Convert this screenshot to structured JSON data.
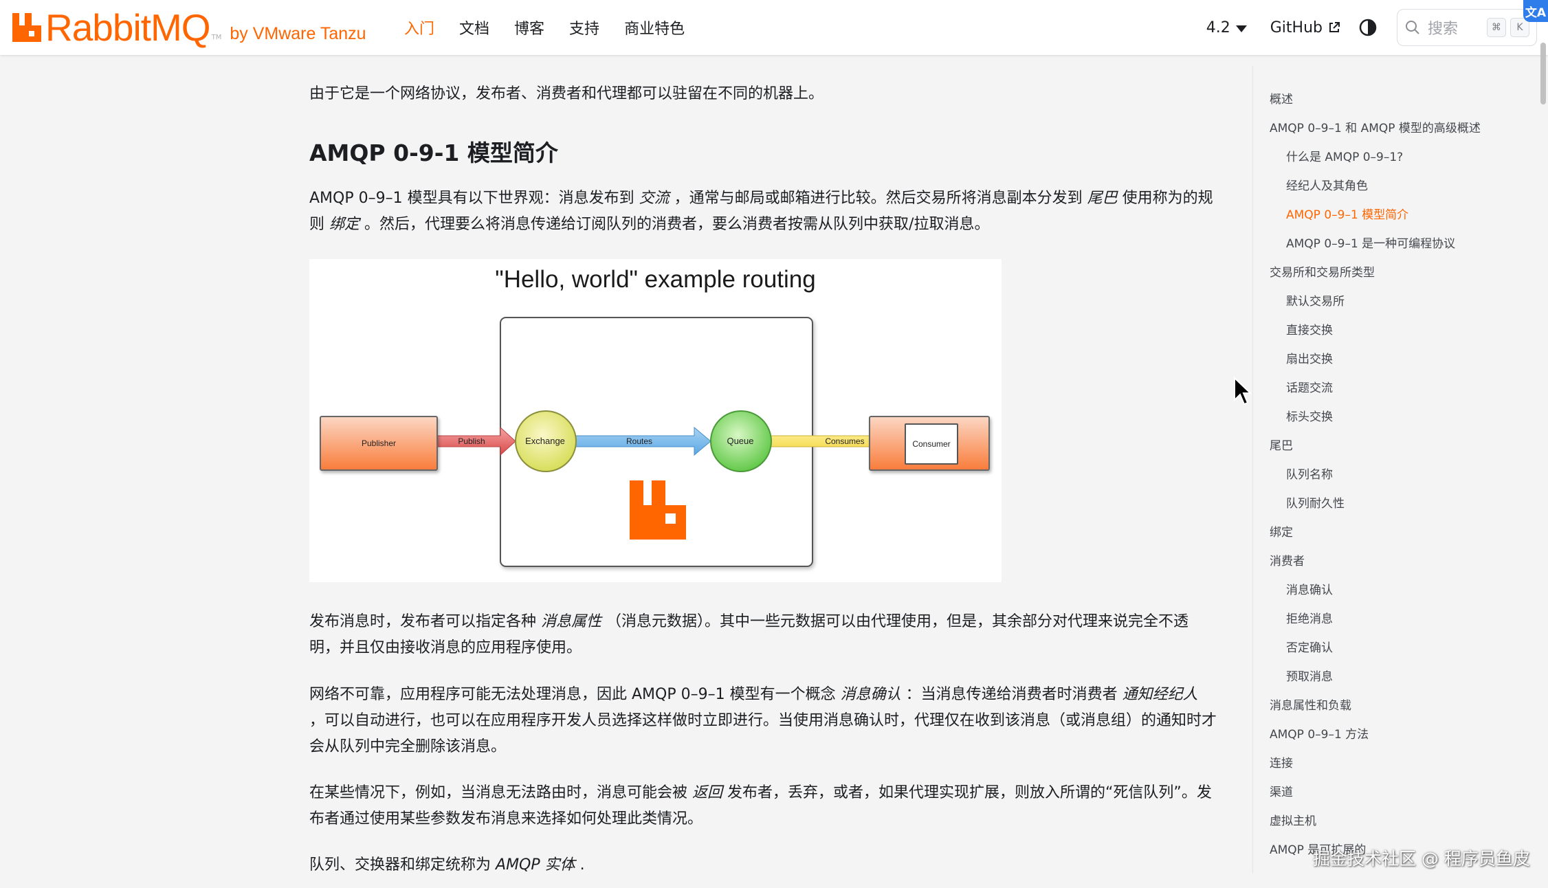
{
  "header": {
    "logo_text": "RabbitMQ",
    "logo_tm": "TM",
    "logo_by": "by VMware Tanzu",
    "nav": [
      {
        "label": "入门",
        "active": true
      },
      {
        "label": "文档",
        "active": false
      },
      {
        "label": "博客",
        "active": false
      },
      {
        "label": "支持",
        "active": false
      },
      {
        "label": "商业特色",
        "active": false
      }
    ],
    "version": "4.2",
    "github": "GitHub",
    "search_placeholder": "搜索",
    "kbd_cmd": "⌘",
    "kbd_k": "K",
    "translate_badge": "文A"
  },
  "colors": {
    "accent": "#ff6600",
    "text": "#1c1e21",
    "background": "#f4f4f5"
  },
  "article": {
    "intro": "由于它是一个网络协议，发布者、消费者和代理都可以驻留在不同的机器上。",
    "heading": "AMQP 0-9-1 模型简介",
    "p1_a": "AMQP 0–9–1 模型具有以下世界观：消息发布到",
    "p1_em1": "交流",
    "p1_b": "，通常与邮局或邮箱进行比较。然后交易所将消息副本分发到",
    "p1_em2": "尾巴",
    "p1_c": "使用称为的规则",
    "p1_em3": "绑定",
    "p1_d": "。然后，代理要么将消息传递给订阅队列的消费者，要么消费者按需从队列中获取/拉取消息。",
    "p2_a": "发布消息时，发布者可以指定各种",
    "p2_em1": "消息属性",
    "p2_b": "（消息元数据）。其中一些元数据可以由代理使用，但是，其余部分对代理来说完全不透明，并且仅由接收消息的应用程序使用。",
    "p3_a": "网络不可靠，应用程序可能无法处理消息，因此 AMQP 0–9–1 模型有一个概念",
    "p3_em1": "消息确认",
    "p3_b": "：当消息传递给消费者时消费者",
    "p3_em2": "通知经纪人",
    "p3_c": "，可以自动进行，也可以在应用程序开发人员选择这样做时立即进行。当使用消息确认时，代理仅在收到该消息（或消息组）的通知时才会从队列中完全删除该消息。",
    "p4_a": "在某些情况下，例如，当消息无法路由时，消息可能会被",
    "p4_em1": "返回",
    "p4_b": "发布者，丢弃，或者，如果代理实现扩展，则放入所谓的“死信队列”。发布者通过使用某些参数发布消息来选择如何处理此类情况。",
    "p5_a": "队列、交换器和绑定统称为",
    "p5_em1": "AMQP 实体",
    "p5_b": "."
  },
  "figure": {
    "title": "\"Hello, world\" example routing",
    "publisher": "Publisher",
    "publish": "Publish",
    "exchange": "Exchange",
    "routes": "Routes",
    "queue": "Queue",
    "consumes": "Consumes",
    "consumer": "Consumer"
  },
  "toc": [
    {
      "label": "概述",
      "level": 0,
      "active": false
    },
    {
      "label": "AMQP 0–9–1 和 AMQP 模型的高级概述",
      "level": 0,
      "active": false
    },
    {
      "label": "什么是 AMQP 0–9–1?",
      "level": 1,
      "active": false
    },
    {
      "label": "经纪人及其角色",
      "level": 1,
      "active": false
    },
    {
      "label": "AMQP 0–9–1 模型简介",
      "level": 1,
      "active": true
    },
    {
      "label": "AMQP 0–9–1 是一种可编程协议",
      "level": 1,
      "active": false
    },
    {
      "label": "交易所和交易所类型",
      "level": 0,
      "active": false
    },
    {
      "label": "默认交易所",
      "level": 1,
      "active": false
    },
    {
      "label": "直接交换",
      "level": 1,
      "active": false
    },
    {
      "label": "扇出交换",
      "level": 1,
      "active": false
    },
    {
      "label": "话题交流",
      "level": 1,
      "active": false
    },
    {
      "label": "标头交换",
      "level": 1,
      "active": false
    },
    {
      "label": "尾巴",
      "level": 0,
      "active": false
    },
    {
      "label": "队列名称",
      "level": 1,
      "active": false
    },
    {
      "label": "队列耐久性",
      "level": 1,
      "active": false
    },
    {
      "label": "绑定",
      "level": 0,
      "active": false
    },
    {
      "label": "消费者",
      "level": 0,
      "active": false
    },
    {
      "label": "消息确认",
      "level": 1,
      "active": false
    },
    {
      "label": "拒绝消息",
      "level": 1,
      "active": false
    },
    {
      "label": "否定确认",
      "level": 1,
      "active": false
    },
    {
      "label": "预取消息",
      "level": 1,
      "active": false
    },
    {
      "label": "消息属性和负载",
      "level": 0,
      "active": false
    },
    {
      "label": "AMQP 0–9–1 方法",
      "level": 0,
      "active": false
    },
    {
      "label": "连接",
      "level": 0,
      "active": false
    },
    {
      "label": "渠道",
      "level": 0,
      "active": false
    },
    {
      "label": "虚拟主机",
      "level": 0,
      "active": false
    },
    {
      "label": "AMQP 是可扩展的",
      "level": 0,
      "active": false
    }
  ],
  "watermark": "掘金技术社区 @ 程序员鱼皮"
}
